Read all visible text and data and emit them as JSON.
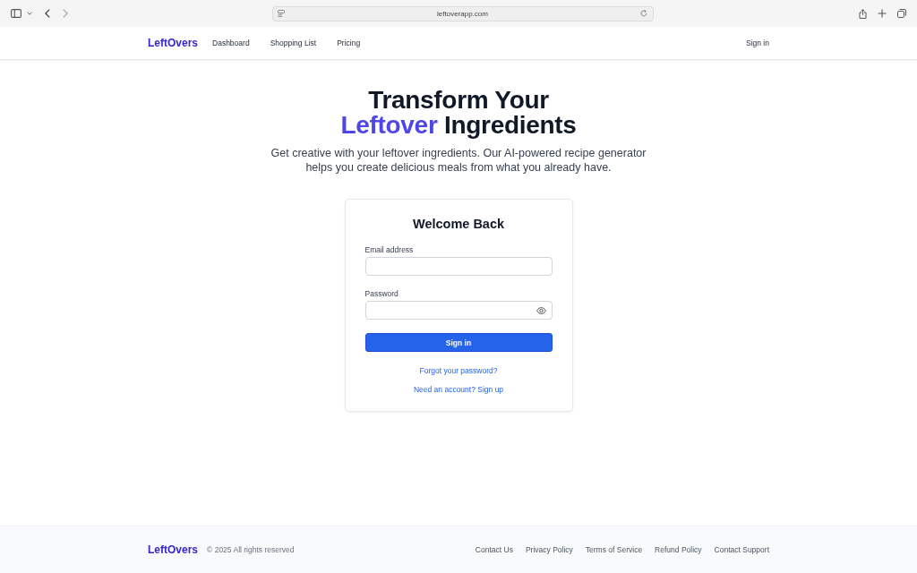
{
  "browser": {
    "url": "leftoverapp.com"
  },
  "nav": {
    "brand": "LeftOvers",
    "links": [
      {
        "label": "Dashboard"
      },
      {
        "label": "Shopping List"
      },
      {
        "label": "Pricing"
      }
    ],
    "sign_in": "Sign in"
  },
  "hero": {
    "title": "Transform Your",
    "highlight": "Leftover",
    "title_end": "Ingredients",
    "subtitle": "Get creative with your leftover ingredients. Our AI-powered recipe generator helps you create delicious meals from what you already have."
  },
  "login": {
    "title": "Welcome Back",
    "fields": [
      {
        "label": "Email address",
        "kind": "email"
      },
      {
        "label": "Password",
        "kind": "password"
      }
    ],
    "submit": "Sign in",
    "links": [
      "Forgot your password?",
      "Need an account? Sign up"
    ]
  },
  "footer": {
    "brand": "LeftOvers",
    "copyright": "© 2025 All rights reserved",
    "links": [
      "Contact Us",
      "Privacy Policy",
      "Terms of Service",
      "Refund Policy",
      "Contact Support"
    ]
  }
}
